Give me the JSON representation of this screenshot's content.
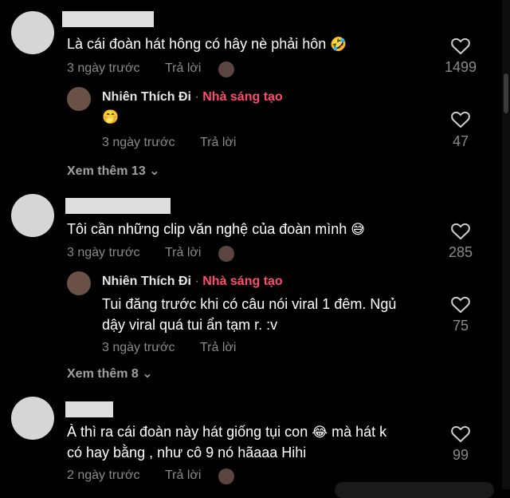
{
  "comments": [
    {
      "text": "Là cái đoàn hát hông có hây nè phải hôn",
      "emoji": "🤣",
      "time": "3 ngày trước",
      "reply_label": "Trả lời",
      "likes": "1499",
      "reply": {
        "name": "Nhiên Thích Đi",
        "separator": "·",
        "badge": "Nhà sáng tạo",
        "text_line1": "",
        "text_line2": "",
        "emoji": "🤭",
        "time": "3 ngày trước",
        "reply_label": "Trả lời",
        "likes": "47"
      },
      "more_label": "Xem thêm 13"
    },
    {
      "text": "Tôi cần những clip văn nghệ của đoàn mình",
      "emoji": "😅",
      "time": "3 ngày trước",
      "reply_label": "Trả lời",
      "likes": "285",
      "reply": {
        "name": "Nhiên Thích Đi",
        "separator": "·",
        "badge": "Nhà sáng tạo",
        "text_line1": "Tui đăng trước khi có câu nói viral 1 đêm. Ngủ",
        "text_line2": "dậy viral quá tui ẩn tạm r. :v",
        "time": "3 ngày trước",
        "reply_label": "Trả lời",
        "likes": "75"
      },
      "more_label": "Xem thêm 8"
    },
    {
      "text_line1": "À thì ra cái đoàn này hát giống tụi con",
      "emoji": "😂",
      "text_line1_after": "mà hát k",
      "text_line2": "có hay bằng , như cô 9 nó hãaaa Hihi",
      "time": "2 ngày trước",
      "reply_label": "Trả lời",
      "likes": "99"
    }
  ]
}
